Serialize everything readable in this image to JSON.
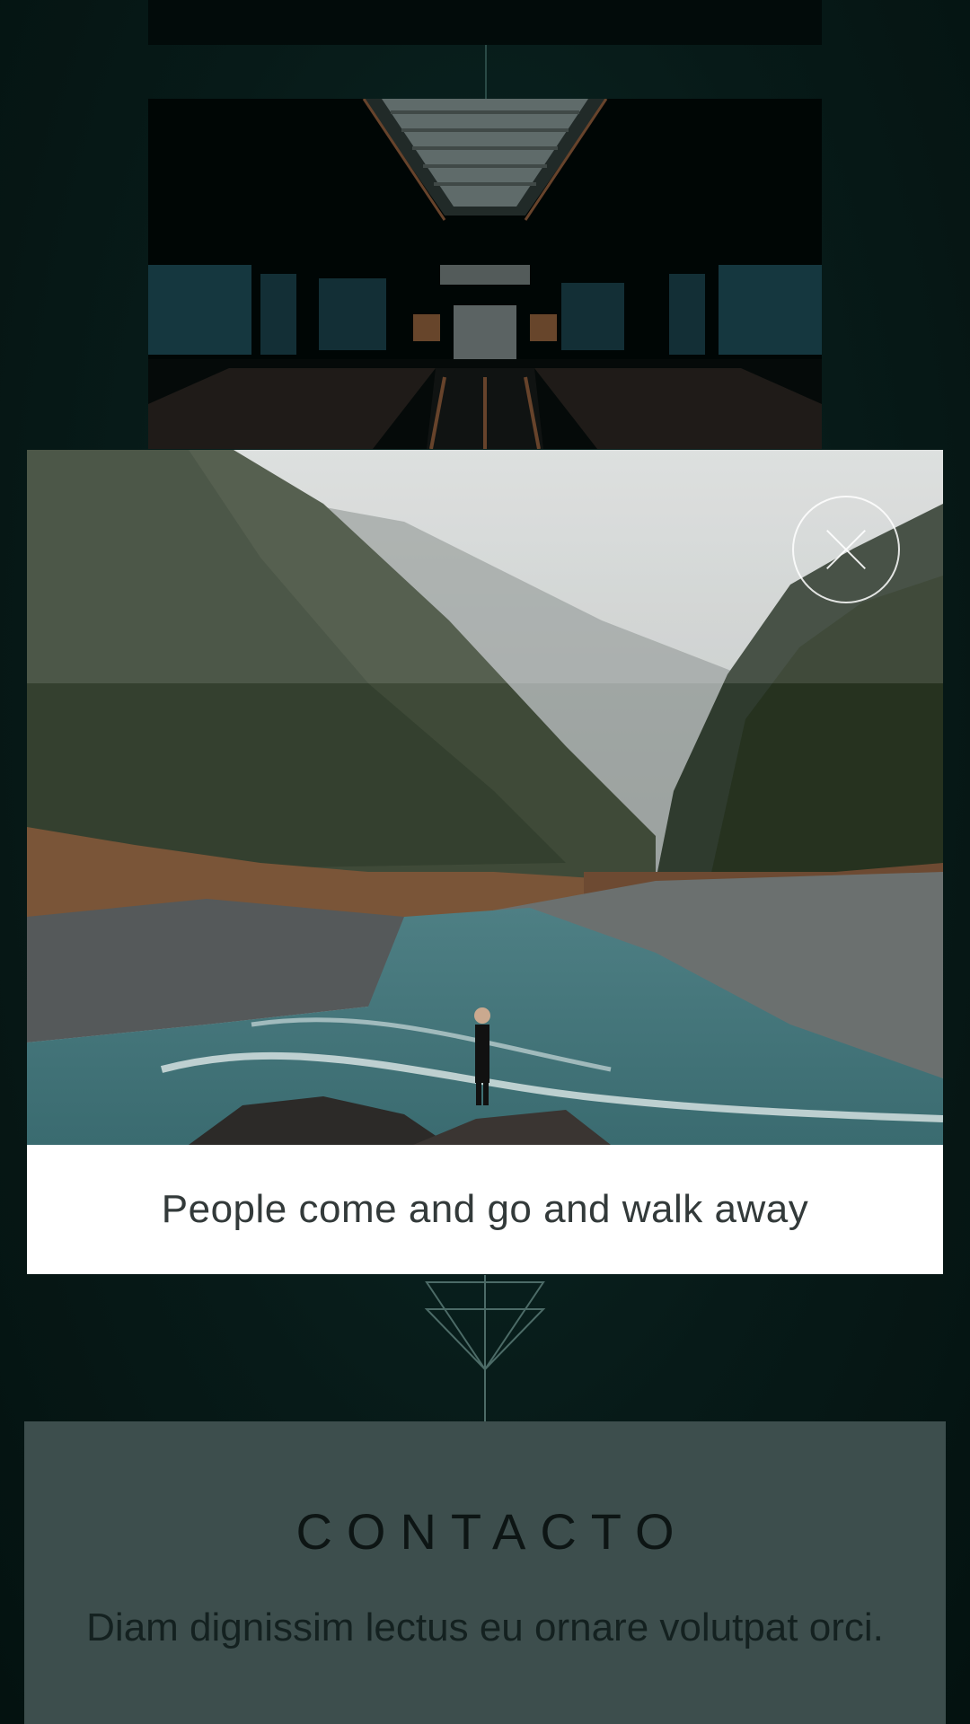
{
  "gallery": {
    "top_image": {
      "icon": "photo-dark-placeholder"
    },
    "escalator_image": {
      "icon": "escalator-photo"
    }
  },
  "lightbox": {
    "image": {
      "icon": "river-forest-photo"
    },
    "caption": "People come and go and walk away",
    "close_icon": "close-icon"
  },
  "ornament": {
    "icon": "triangle-ornament-icon"
  },
  "contact": {
    "title": "CONTACTO",
    "text": "Diam dignissim lectus eu ornare volutpat orci."
  },
  "colors": {
    "background": "#071a18",
    "contact_panel": "#3d4e4d",
    "caption_text": "#333a3a",
    "modal_background": "#ffffff"
  }
}
